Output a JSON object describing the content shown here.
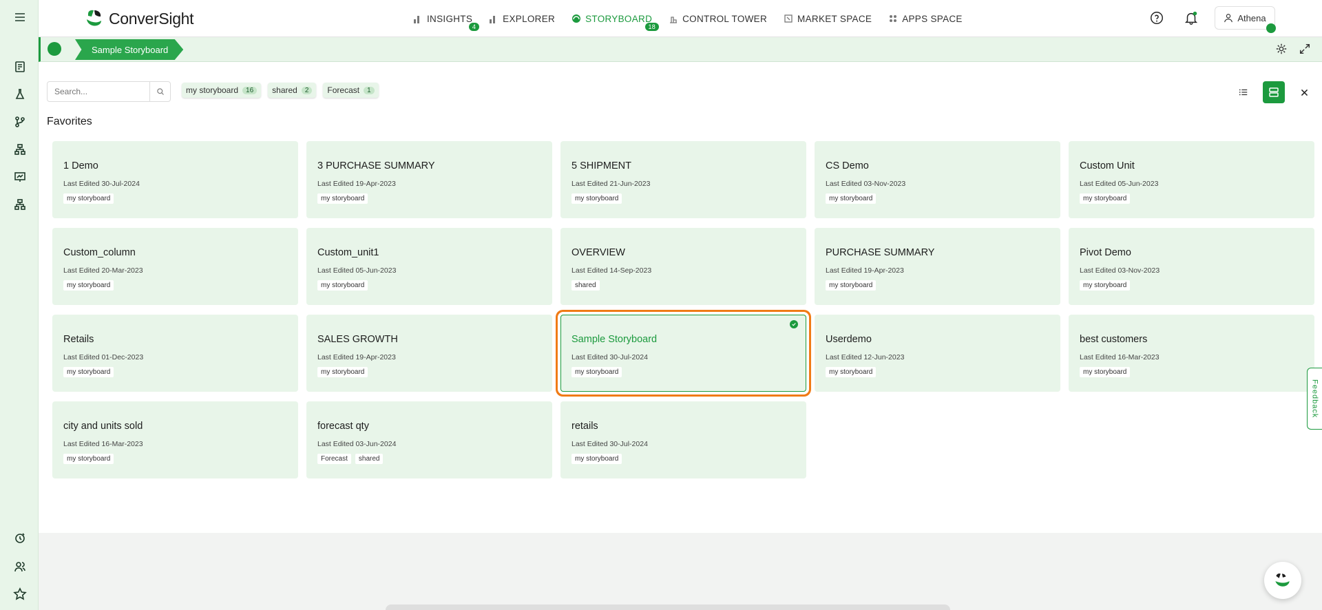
{
  "app": {
    "name": "ConverSight"
  },
  "nav": [
    {
      "label": "INSIGHTS",
      "badge": "4",
      "icon": "bar-chart-icon",
      "active": false
    },
    {
      "label": "EXPLORER",
      "badge": "",
      "icon": "bar-chart-icon",
      "active": false
    },
    {
      "label": "STORYBOARD",
      "badge": "18",
      "icon": "storyboard-icon",
      "active": true
    },
    {
      "label": "CONTROL TOWER",
      "badge": "",
      "icon": "tower-icon",
      "active": false
    },
    {
      "label": "MARKET SPACE",
      "badge": "",
      "icon": "market-icon",
      "active": false
    },
    {
      "label": "APPS SPACE",
      "badge": "",
      "icon": "apps-icon",
      "active": false
    }
  ],
  "user": {
    "name": "Athena"
  },
  "breadcrumb": {
    "current": "Sample Storyboard"
  },
  "search": {
    "placeholder": "Search..."
  },
  "filters": [
    {
      "label": "my storyboard",
      "count": "16"
    },
    {
      "label": "shared",
      "count": "2"
    },
    {
      "label": "Forecast",
      "count": "1"
    }
  ],
  "section_title": "Favorites",
  "cards": [
    {
      "title": "1 Demo",
      "edited": "Last Edited 30-Jul-2024",
      "tags": [
        "my storyboard"
      ]
    },
    {
      "title": "3 PURCHASE SUMMARY",
      "edited": "Last Edited 19-Apr-2023",
      "tags": [
        "my storyboard"
      ]
    },
    {
      "title": "5 SHIPMENT",
      "edited": "Last Edited 21-Jun-2023",
      "tags": [
        "my storyboard"
      ]
    },
    {
      "title": "CS Demo",
      "edited": "Last Edited 03-Nov-2023",
      "tags": [
        "my storyboard"
      ]
    },
    {
      "title": "Custom Unit",
      "edited": "Last Edited 05-Jun-2023",
      "tags": [
        "my storyboard"
      ]
    },
    {
      "title": "Custom_column",
      "edited": "Last Edited 20-Mar-2023",
      "tags": [
        "my storyboard"
      ]
    },
    {
      "title": "Custom_unit1",
      "edited": "Last Edited 05-Jun-2023",
      "tags": [
        "my storyboard"
      ]
    },
    {
      "title": "OVERVIEW",
      "edited": "Last Edited 14-Sep-2023",
      "tags": [
        "shared"
      ]
    },
    {
      "title": "PURCHASE SUMMARY",
      "edited": "Last Edited 19-Apr-2023",
      "tags": [
        "my storyboard"
      ]
    },
    {
      "title": "Pivot Demo",
      "edited": "Last Edited 03-Nov-2023",
      "tags": [
        "my storyboard"
      ]
    },
    {
      "title": "Retails",
      "edited": "Last Edited 01-Dec-2023",
      "tags": [
        "my storyboard"
      ]
    },
    {
      "title": "SALES GROWTH",
      "edited": "Last Edited 19-Apr-2023",
      "tags": [
        "my storyboard"
      ]
    },
    {
      "title": "Sample Storyboard",
      "edited": "Last Edited 30-Jul-2024",
      "tags": [
        "my storyboard"
      ],
      "selected": true
    },
    {
      "title": "Userdemo",
      "edited": "Last Edited 12-Jun-2023",
      "tags": [
        "my storyboard"
      ]
    },
    {
      "title": "best customers",
      "edited": "Last Edited 16-Mar-2023",
      "tags": [
        "my storyboard"
      ]
    },
    {
      "title": "city and units sold",
      "edited": "Last Edited 16-Mar-2023",
      "tags": [
        "my storyboard"
      ]
    },
    {
      "title": "forecast qty",
      "edited": "Last Edited 03-Jun-2024",
      "tags": [
        "Forecast",
        "shared"
      ]
    },
    {
      "title": "retails",
      "edited": "Last Edited 30-Jul-2024",
      "tags": [
        "my storyboard"
      ]
    }
  ],
  "feedback": {
    "label": "Feedback"
  },
  "colors": {
    "accent": "#1c9a3e",
    "card_bg": "#e8f5e9",
    "highlight": "#f07b16"
  }
}
